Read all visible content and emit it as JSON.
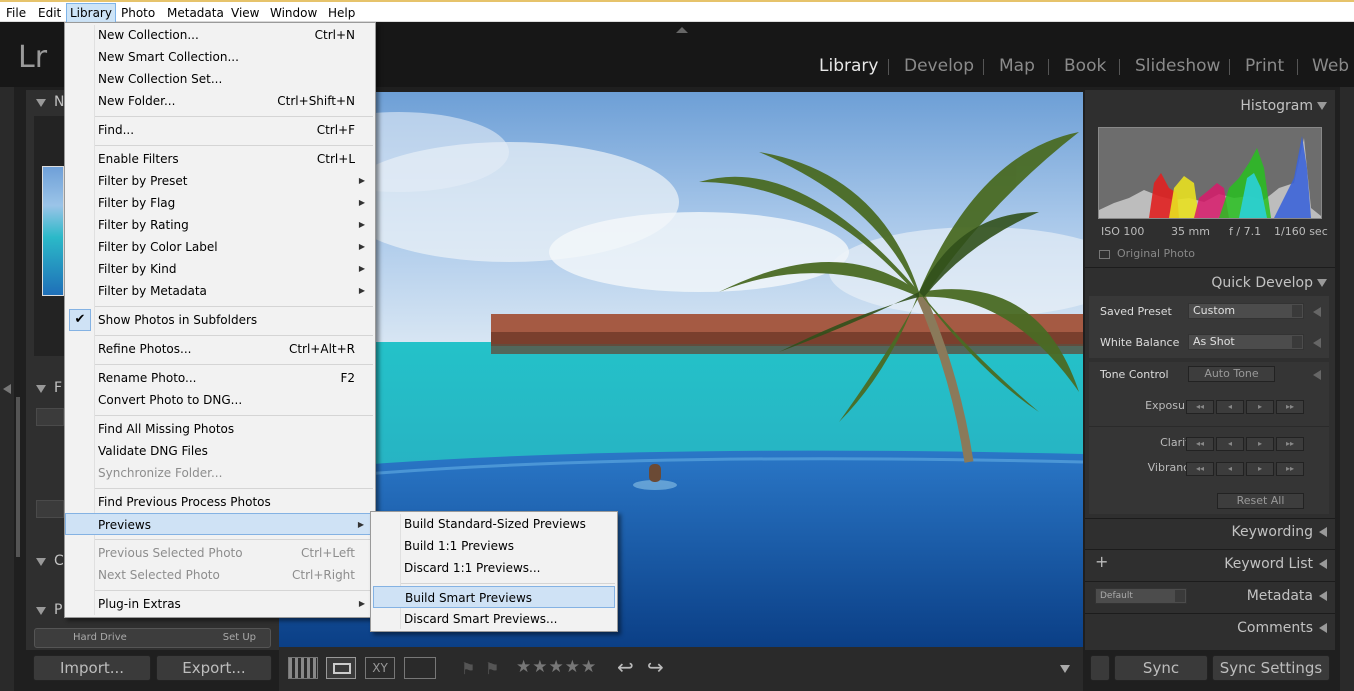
{
  "menubar": [
    "File",
    "Edit",
    "Library",
    "Photo",
    "Metadata",
    "View",
    "Window",
    "Help"
  ],
  "app": {
    "logo": "Lr"
  },
  "modules": [
    "Library",
    "Develop",
    "Map",
    "Book",
    "Slideshow",
    "Print",
    "Web"
  ],
  "left_panel": {
    "section_letters": [
      "N",
      "F",
      "C",
      "P"
    ],
    "hard_drive": "Hard Drive",
    "setup": "Set Up"
  },
  "right_panel": {
    "histogram_title": "Histogram",
    "histogram_info": {
      "iso": "ISO 100",
      "focal": "35 mm",
      "aperture": "f / 7.1",
      "shutter": "1/160 sec"
    },
    "original_photo": "Original Photo",
    "quick_develop_title": "Quick Develop",
    "saved_preset_label": "Saved Preset",
    "saved_preset_value": "Custom",
    "white_balance_label": "White Balance",
    "white_balance_value": "As Shot",
    "tone_control_label": "Tone Control",
    "auto_tone": "Auto Tone",
    "exposure": "Exposure",
    "clarity": "Clarity",
    "vibrance": "Vibrance",
    "reset_all": "Reset All",
    "keywording": "Keywording",
    "keyword_list": "Keyword List",
    "metadata_preset": "Default",
    "metadata": "Metadata",
    "comments": "Comments",
    "sync": "Sync",
    "sync_settings": "Sync Settings"
  },
  "bottom": {
    "import": "Import...",
    "export": "Export..."
  },
  "library_menu": [
    {
      "label": "New Collection...",
      "shortcut": "Ctrl+N"
    },
    {
      "label": "New Smart Collection...",
      "shortcut": ""
    },
    {
      "label": "New Collection Set...",
      "shortcut": ""
    },
    {
      "label": "New Folder...",
      "shortcut": "Ctrl+Shift+N"
    },
    {
      "label": "Find...",
      "shortcut": "Ctrl+F"
    },
    {
      "label": "Enable Filters",
      "shortcut": "Ctrl+L"
    },
    {
      "label": "Filter by Preset",
      "shortcut": ""
    },
    {
      "label": "Filter by Flag",
      "shortcut": ""
    },
    {
      "label": "Filter by Rating",
      "shortcut": ""
    },
    {
      "label": "Filter by Color Label",
      "shortcut": ""
    },
    {
      "label": "Filter by Kind",
      "shortcut": ""
    },
    {
      "label": "Filter by Metadata",
      "shortcut": ""
    },
    {
      "label": "Show Photos in Subfolders",
      "shortcut": ""
    },
    {
      "label": "Refine Photos...",
      "shortcut": "Ctrl+Alt+R"
    },
    {
      "label": "Rename Photo...",
      "shortcut": "F2"
    },
    {
      "label": "Convert Photo to DNG...",
      "shortcut": ""
    },
    {
      "label": "Find All Missing Photos",
      "shortcut": ""
    },
    {
      "label": "Validate DNG Files",
      "shortcut": ""
    },
    {
      "label": "Synchronize Folder...",
      "shortcut": ""
    },
    {
      "label": "Find Previous Process Photos",
      "shortcut": ""
    },
    {
      "label": "Previews",
      "shortcut": ""
    },
    {
      "label": "Previous Selected Photo",
      "shortcut": "Ctrl+Left"
    },
    {
      "label": "Next Selected Photo",
      "shortcut": "Ctrl+Right"
    },
    {
      "label": "Plug-in Extras",
      "shortcut": ""
    }
  ],
  "previews_menu": [
    {
      "label": "Build Standard-Sized Previews"
    },
    {
      "label": "Build 1:1 Previews"
    },
    {
      "label": "Discard 1:1 Previews..."
    },
    {
      "label": "Build Smart Previews"
    },
    {
      "label": "Discard Smart Previews..."
    }
  ],
  "colors": {
    "menu_highlight": "#cfe2f5",
    "panel_bg": "#2f2f2f",
    "chrome_bg": "#171717"
  }
}
